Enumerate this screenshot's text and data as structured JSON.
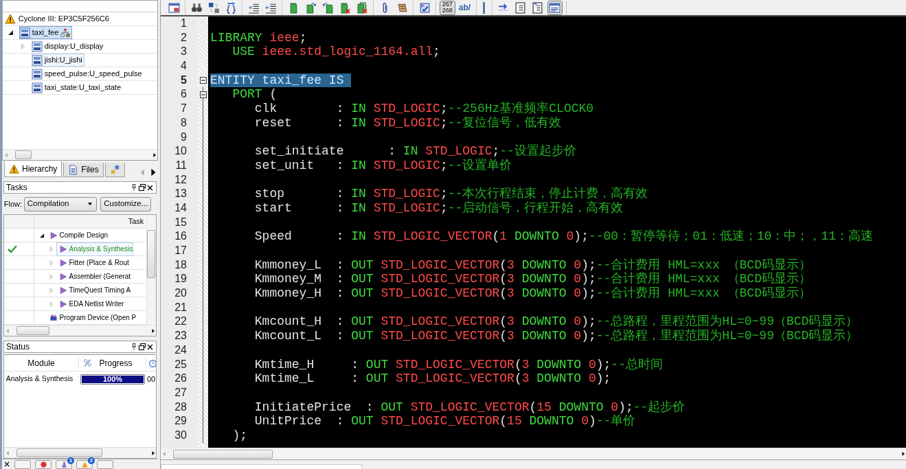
{
  "hierarchy": {
    "device": "Cyclone III: EP3C5F256C6",
    "tree": [
      {
        "label": "taxi_fee",
        "selected": true,
        "highlighted": true,
        "expanded": true,
        "children": [
          {
            "label": "display:U_display",
            "selected": false,
            "highlighted": false,
            "expanded": false
          },
          {
            "label": "jishi:U_jishi",
            "selected": false,
            "highlighted": true
          },
          {
            "label": "speed_pulse:U_speed_pulse",
            "selected": false,
            "highlighted": false
          },
          {
            "label": "taxi_state:U_taxi_state",
            "selected": false,
            "highlighted": false
          }
        ]
      }
    ]
  },
  "panel_tabs": [
    {
      "label": "Hierarchy",
      "selected": true
    },
    {
      "label": "Files",
      "selected": false
    },
    {
      "selected": false
    }
  ],
  "tasks": {
    "title": "Tasks",
    "flow_label": "Flow:",
    "flow_value": "Compilation",
    "customize": "Customize...",
    "column": "Task",
    "rows": [
      {
        "kind": "task",
        "label": "Compile Design",
        "done": false,
        "selected": false,
        "expanded": true,
        "children": [
          {
            "kind": "task",
            "label": "Analysis & Synthesis",
            "done": true,
            "selected": true,
            "expanded": false
          },
          {
            "kind": "task",
            "label": "Fitter (Place & Rout",
            "done": false,
            "selected": false,
            "expanded": false
          },
          {
            "kind": "task",
            "label": "Assembler (Generat",
            "done": false,
            "selected": false,
            "expanded": false
          },
          {
            "kind": "task",
            "label": "TimeQuest Timing A",
            "done": false,
            "selected": false,
            "expanded": false
          },
          {
            "kind": "task",
            "label": "EDA Netlist Writer",
            "done": false,
            "selected": false,
            "expanded": false
          }
        ]
      },
      {
        "kind": "program",
        "label": "Program Device (Open P",
        "done": false,
        "selected": false
      }
    ]
  },
  "status": {
    "title": "Status",
    "columns": [
      "Module",
      "Progress"
    ],
    "rows": [
      {
        "module": "Analysis & Synthesis",
        "level": 1,
        "progress": "100%",
        "time": "00"
      }
    ]
  },
  "bottom_bar": {
    "badges": [
      "1",
      "2"
    ]
  },
  "toolbar": [
    [
      {
        "kind": "window",
        "pressed": false
      }
    ],
    [
      {
        "kind": "find",
        "pressed": false
      },
      {
        "kind": "replace",
        "pressed": false
      },
      {
        "kind": "braces",
        "pressed": false
      }
    ],
    [
      {
        "kind": "indent",
        "pressed": false
      },
      {
        "kind": "outdent",
        "pressed": false
      }
    ],
    [
      {
        "kind": "bookmark",
        "pressed": false
      },
      {
        "kind": "bookmark_next",
        "pressed": false
      },
      {
        "kind": "bookmark_prev",
        "pressed": false
      },
      {
        "kind": "bookmark_delete",
        "pressed": false
      },
      {
        "kind": "bookmark_clear",
        "pressed": false
      }
    ],
    [
      {
        "kind": "attach",
        "pressed": false
      },
      {
        "kind": "scroll",
        "pressed": false
      }
    ],
    [
      {
        "kind": "checklist",
        "pressed": false
      }
    ],
    [
      {
        "kind": "text",
        "label": [
          "267",
          "268"
        ],
        "pressed": true
      },
      {
        "kind": "label",
        "label": [
          "ab/"
        ],
        "pressed": false
      }
    ],
    [
      {
        "kind": "bar",
        "pressed": false
      }
    ],
    [
      {
        "kind": "arrow",
        "pressed": false
      },
      {
        "kind": "document",
        "pressed": false
      },
      {
        "kind": "document_corner",
        "pressed": false
      },
      {
        "kind": "panel",
        "pressed": true
      }
    ]
  ],
  "editor": {
    "lines": [
      {
        "number": "1",
        "selected": false,
        "foldable": false
      },
      {
        "number": "2",
        "selected": false,
        "foldable": false,
        "tokens": [
          {
            "kind": "keyword",
            "text": "LIBRARY"
          },
          {
            "kind": "type",
            "text": " ieee"
          },
          {
            "kind": "plain",
            "text": ";"
          }
        ]
      },
      {
        "number": "3",
        "selected": false,
        "foldable": false,
        "tokens": [
          {
            "kind": "keyword",
            "text": "   USE"
          },
          {
            "kind": "type",
            "text": " ieee.std_logic_1164.all"
          },
          {
            "kind": "plain",
            "text": ";"
          }
        ]
      },
      {
        "number": "4",
        "selected": false,
        "foldable": false
      },
      {
        "number": "5",
        "selected": true,
        "foldable": true,
        "tokens": [
          {
            "kind": "keyword",
            "text": "ENTITY"
          },
          {
            "kind": "plain",
            "text": " taxi_fee "
          },
          {
            "kind": "keyword",
            "text": "IS "
          }
        ]
      },
      {
        "number": "6",
        "selected": false,
        "foldable": true,
        "tokens": [
          {
            "kind": "keyword",
            "text": "   PORT"
          },
          {
            "kind": "plain",
            "text": " ("
          }
        ]
      },
      {
        "number": "7",
        "selected": false,
        "foldable": false,
        "tokens": [
          {
            "kind": "plain",
            "text": "      clk        : "
          },
          {
            "kind": "keyword",
            "text": "IN"
          },
          {
            "kind": "type",
            "text": " STD_LOGIC"
          },
          {
            "kind": "plain",
            "text": ";"
          },
          {
            "kind": "comment",
            "text": "--256Hz基准频率CLOCK0"
          }
        ]
      },
      {
        "number": "8",
        "selected": false,
        "foldable": false,
        "tokens": [
          {
            "kind": "plain",
            "text": "      reset      : "
          },
          {
            "kind": "keyword",
            "text": "IN"
          },
          {
            "kind": "type",
            "text": " STD_LOGIC"
          },
          {
            "kind": "plain",
            "text": ";"
          },
          {
            "kind": "comment",
            "text": "--复位信号，低有效"
          }
        ]
      },
      {
        "number": "9",
        "selected": false,
        "foldable": false
      },
      {
        "number": "10",
        "selected": false,
        "foldable": false,
        "tokens": [
          {
            "kind": "plain",
            "text": "      set_initiate      : "
          },
          {
            "kind": "keyword",
            "text": "IN"
          },
          {
            "kind": "type",
            "text": " STD_LOGIC"
          },
          {
            "kind": "plain",
            "text": ";"
          },
          {
            "kind": "comment",
            "text": "--设置起步价"
          }
        ]
      },
      {
        "number": "11",
        "selected": false,
        "foldable": false,
        "tokens": [
          {
            "kind": "plain",
            "text": "      set_unit   : "
          },
          {
            "kind": "keyword",
            "text": "IN"
          },
          {
            "kind": "type",
            "text": " STD_LOGIC"
          },
          {
            "kind": "plain",
            "text": ";"
          },
          {
            "kind": "comment",
            "text": "--设置单价"
          }
        ]
      },
      {
        "number": "12",
        "selected": false,
        "foldable": false
      },
      {
        "number": "13",
        "selected": false,
        "foldable": false,
        "tokens": [
          {
            "kind": "plain",
            "text": "      stop       : "
          },
          {
            "kind": "keyword",
            "text": "IN"
          },
          {
            "kind": "type",
            "text": " STD_LOGIC"
          },
          {
            "kind": "plain",
            "text": ";"
          },
          {
            "kind": "comment",
            "text": "--本次行程结束，停止计费，高有效"
          }
        ]
      },
      {
        "number": "14",
        "selected": false,
        "foldable": false,
        "tokens": [
          {
            "kind": "plain",
            "text": "      start      : "
          },
          {
            "kind": "keyword",
            "text": "IN"
          },
          {
            "kind": "type",
            "text": " STD_LOGIC"
          },
          {
            "kind": "plain",
            "text": ";"
          },
          {
            "kind": "comment",
            "text": "--启动信号，行程开始，高有效"
          }
        ]
      },
      {
        "number": "15",
        "selected": false,
        "foldable": false
      },
      {
        "number": "16",
        "selected": false,
        "foldable": false,
        "tokens": [
          {
            "kind": "plain",
            "text": "      Speed      : "
          },
          {
            "kind": "keyword",
            "text": "IN"
          },
          {
            "kind": "type",
            "text": " STD_LOGIC_VECTOR"
          },
          {
            "kind": "plain",
            "text": "("
          },
          {
            "kind": "number",
            "text": "1"
          },
          {
            "kind": "keyword",
            "text": " DOWNTO"
          },
          {
            "kind": "number",
            "text": " 0"
          },
          {
            "kind": "plain",
            "text": ");"
          },
          {
            "kind": "comment",
            "text": "--00：暂停等待；01：低速；10：中；，11：高速"
          }
        ]
      },
      {
        "number": "17",
        "selected": false,
        "foldable": false
      },
      {
        "number": "18",
        "selected": false,
        "foldable": false,
        "tokens": [
          {
            "kind": "plain",
            "text": "      Kmmoney_L  : "
          },
          {
            "kind": "keyword",
            "text": "OUT"
          },
          {
            "kind": "type",
            "text": " STD_LOGIC_VECTOR"
          },
          {
            "kind": "plain",
            "text": "("
          },
          {
            "kind": "number",
            "text": "3"
          },
          {
            "kind": "keyword",
            "text": " DOWNTO"
          },
          {
            "kind": "number",
            "text": " 0"
          },
          {
            "kind": "plain",
            "text": ");"
          },
          {
            "kind": "comment",
            "text": "--合计费用 HML=xxx （BCD码显示）"
          }
        ]
      },
      {
        "number": "19",
        "selected": false,
        "foldable": false,
        "tokens": [
          {
            "kind": "plain",
            "text": "      Kmmoney_M  : "
          },
          {
            "kind": "keyword",
            "text": "OUT"
          },
          {
            "kind": "type",
            "text": " STD_LOGIC_VECTOR"
          },
          {
            "kind": "plain",
            "text": "("
          },
          {
            "kind": "number",
            "text": "3"
          },
          {
            "kind": "keyword",
            "text": " DOWNTO"
          },
          {
            "kind": "number",
            "text": " 0"
          },
          {
            "kind": "plain",
            "text": ");"
          },
          {
            "kind": "comment",
            "text": "--合计费用 HML=xxx （BCD码显示）"
          }
        ]
      },
      {
        "number": "20",
        "selected": false,
        "foldable": false,
        "tokens": [
          {
            "kind": "plain",
            "text": "      Kmmoney_H  : "
          },
          {
            "kind": "keyword",
            "text": "OUT"
          },
          {
            "kind": "type",
            "text": " STD_LOGIC_VECTOR"
          },
          {
            "kind": "plain",
            "text": "("
          },
          {
            "kind": "number",
            "text": "3"
          },
          {
            "kind": "keyword",
            "text": " DOWNTO"
          },
          {
            "kind": "number",
            "text": " 0"
          },
          {
            "kind": "plain",
            "text": ");"
          },
          {
            "kind": "comment",
            "text": "--合计费用 HML=xxx （BCD码显示）"
          }
        ]
      },
      {
        "number": "21",
        "selected": false,
        "foldable": false
      },
      {
        "number": "22",
        "selected": false,
        "foldable": false,
        "tokens": [
          {
            "kind": "plain",
            "text": "      Kmcount_H  : "
          },
          {
            "kind": "keyword",
            "text": "OUT"
          },
          {
            "kind": "type",
            "text": " STD_LOGIC_VECTOR"
          },
          {
            "kind": "plain",
            "text": "("
          },
          {
            "kind": "number",
            "text": "3"
          },
          {
            "kind": "keyword",
            "text": " DOWNTO"
          },
          {
            "kind": "number",
            "text": " 0"
          },
          {
            "kind": "plain",
            "text": ");"
          },
          {
            "kind": "comment",
            "text": "--总路程，里程范围为HL=0~99（BCD码显示）"
          }
        ]
      },
      {
        "number": "23",
        "selected": false,
        "foldable": false,
        "tokens": [
          {
            "kind": "plain",
            "text": "      Kmcount_L  : "
          },
          {
            "kind": "keyword",
            "text": "OUT"
          },
          {
            "kind": "type",
            "text": " STD_LOGIC_VECTOR"
          },
          {
            "kind": "plain",
            "text": "("
          },
          {
            "kind": "number",
            "text": "3"
          },
          {
            "kind": "keyword",
            "text": " DOWNTO"
          },
          {
            "kind": "number",
            "text": " 0"
          },
          {
            "kind": "plain",
            "text": ");"
          },
          {
            "kind": "comment",
            "text": "--总路程，里程范围为HL=0~99（BCD码显示）"
          }
        ]
      },
      {
        "number": "24",
        "selected": false,
        "foldable": false
      },
      {
        "number": "25",
        "selected": false,
        "foldable": false,
        "tokens": [
          {
            "kind": "plain",
            "text": "      Kmtime_H     : "
          },
          {
            "kind": "keyword",
            "text": "OUT"
          },
          {
            "kind": "type",
            "text": " STD_LOGIC_VECTOR"
          },
          {
            "kind": "plain",
            "text": "("
          },
          {
            "kind": "number",
            "text": "3"
          },
          {
            "kind": "keyword",
            "text": " DOWNTO"
          },
          {
            "kind": "number",
            "text": " 0"
          },
          {
            "kind": "plain",
            "text": ");"
          },
          {
            "kind": "comment",
            "text": "--总时间"
          }
        ]
      },
      {
        "number": "26",
        "selected": false,
        "foldable": false,
        "tokens": [
          {
            "kind": "plain",
            "text": "      Kmtime_L     : "
          },
          {
            "kind": "keyword",
            "text": "OUT"
          },
          {
            "kind": "type",
            "text": " STD_LOGIC_VECTOR"
          },
          {
            "kind": "plain",
            "text": "("
          },
          {
            "kind": "number",
            "text": "3"
          },
          {
            "kind": "keyword",
            "text": " DOWNTO"
          },
          {
            "kind": "number",
            "text": " 0"
          },
          {
            "kind": "plain",
            "text": ");"
          }
        ]
      },
      {
        "number": "27",
        "selected": false,
        "foldable": false
      },
      {
        "number": "28",
        "selected": false,
        "foldable": false,
        "tokens": [
          {
            "kind": "plain",
            "text": "      InitiatePrice  : "
          },
          {
            "kind": "keyword",
            "text": "OUT"
          },
          {
            "kind": "type",
            "text": " STD_LOGIC_VECTOR"
          },
          {
            "kind": "plain",
            "text": "("
          },
          {
            "kind": "number",
            "text": "15"
          },
          {
            "kind": "keyword",
            "text": " DOWNTO"
          },
          {
            "kind": "number",
            "text": " 0"
          },
          {
            "kind": "plain",
            "text": ");"
          },
          {
            "kind": "comment",
            "text": "--起步价"
          }
        ]
      },
      {
        "number": "29",
        "selected": false,
        "foldable": false,
        "tokens": [
          {
            "kind": "plain",
            "text": "      UnitPrice  : "
          },
          {
            "kind": "keyword",
            "text": "OUT"
          },
          {
            "kind": "type",
            "text": " STD_LOGIC_VECTOR"
          },
          {
            "kind": "plain",
            "text": "("
          },
          {
            "kind": "number",
            "text": "15"
          },
          {
            "kind": "keyword",
            "text": " DOWNTO"
          },
          {
            "kind": "number",
            "text": " 0"
          },
          {
            "kind": "plain",
            "text": ")"
          },
          {
            "kind": "comment",
            "text": "--单价"
          }
        ]
      },
      {
        "number": "30",
        "selected": false,
        "foldable": false,
        "tokens": [
          {
            "kind": "plain",
            "text": "   );"
          }
        ]
      }
    ]
  }
}
